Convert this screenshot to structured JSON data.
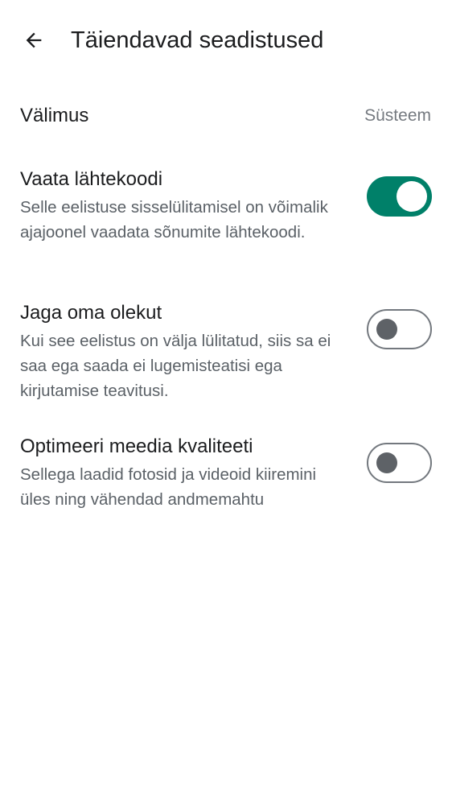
{
  "header": {
    "back_icon": "arrow-left-icon",
    "title": "Täiendavad seadistused"
  },
  "appearance": {
    "label": "Välimus",
    "value": "Süsteem"
  },
  "settings": [
    {
      "title": "Vaata lähtekoodi",
      "description": "Selle eelistuse sisselülitamisel on võimalik ajajoonel vaadata sõnumite lähtekoodi.",
      "enabled": true
    },
    {
      "title": "Jaga oma olekut",
      "description": "Kui see eelistus on välja lülitatud, siis sa ei saa ega saada ei lugemisteatisi ega kirjutamise teavitusi.",
      "enabled": false
    },
    {
      "title": "Optimeeri meedia kvaliteeti",
      "description": "Sellega laadid fotosid ja videoid kiiremini üles ning vähendad andmemahtu",
      "enabled": false
    }
  ],
  "colors": {
    "toggle_on": "#008069",
    "toggle_off_outline": "#73787e",
    "secondary_text": "#5b6167"
  }
}
